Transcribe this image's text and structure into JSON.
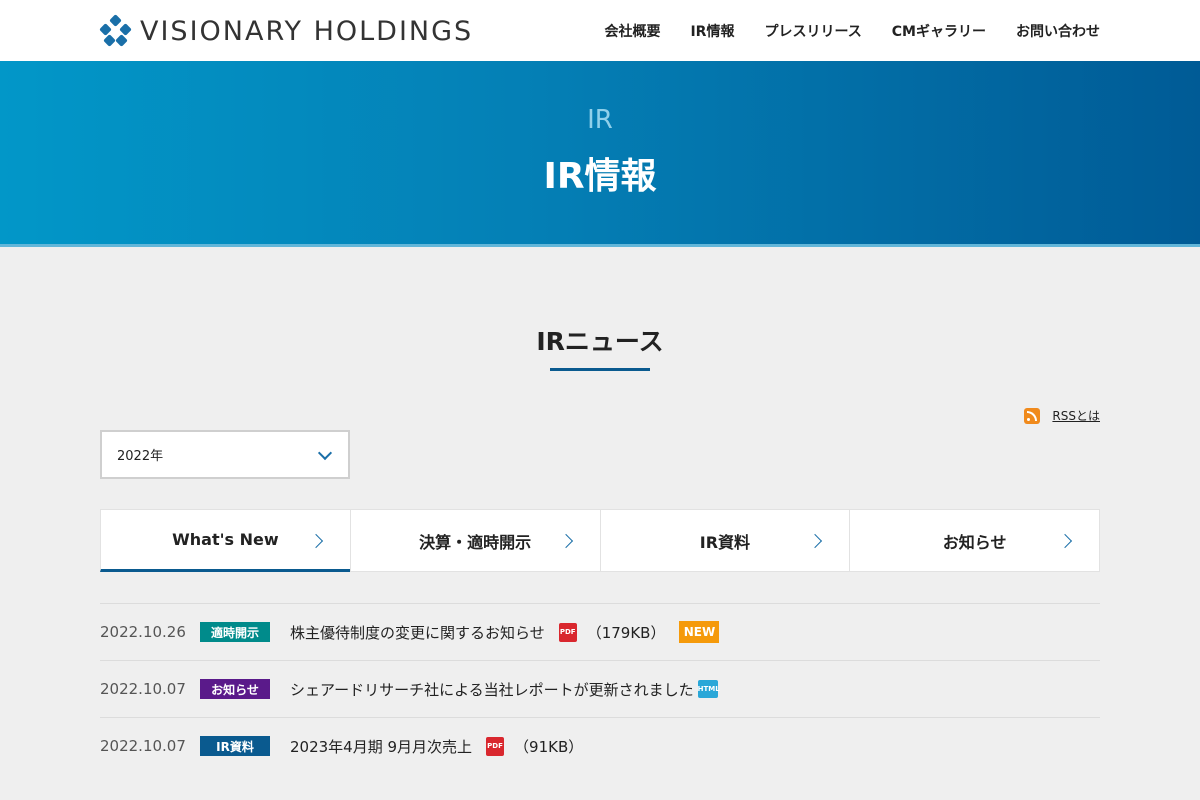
{
  "header": {
    "logo_text": "VISIONARY HOLDINGS",
    "nav": [
      "会社概要",
      "IR情報",
      "プレスリリース",
      "CMギャラリー",
      "お問い合わせ"
    ]
  },
  "hero": {
    "subtitle": "IR",
    "title": "IR情報"
  },
  "section": {
    "title": "IRニュース"
  },
  "rss": {
    "label": "RSSとは"
  },
  "year_select": {
    "value": "2022年"
  },
  "tabs": [
    "What's New",
    "決算・適時開示",
    "IR資料",
    "お知らせ"
  ],
  "colors": {
    "accent": "#0a5a8f",
    "badge_teal": "#008b8b",
    "badge_purple": "#5a1a8a",
    "badge_navy": "#0a5a8f",
    "new": "#f59a0b"
  },
  "news": [
    {
      "date": "2022.10.26",
      "category": "適時開示",
      "title": "株主優待制度の変更に関するお知らせ",
      "icon": "pdf-icon",
      "size": "（179KB）",
      "new": "NEW"
    },
    {
      "date": "2022.10.07",
      "category": "お知らせ",
      "title": "シェアードリサーチ社による当社レポートが更新されました",
      "icon": "html-icon"
    },
    {
      "date": "2022.10.07",
      "category": "IR資料",
      "title": "2023年4月期 9月月次売上",
      "icon": "pdf-icon",
      "size": "（91KB）"
    }
  ]
}
